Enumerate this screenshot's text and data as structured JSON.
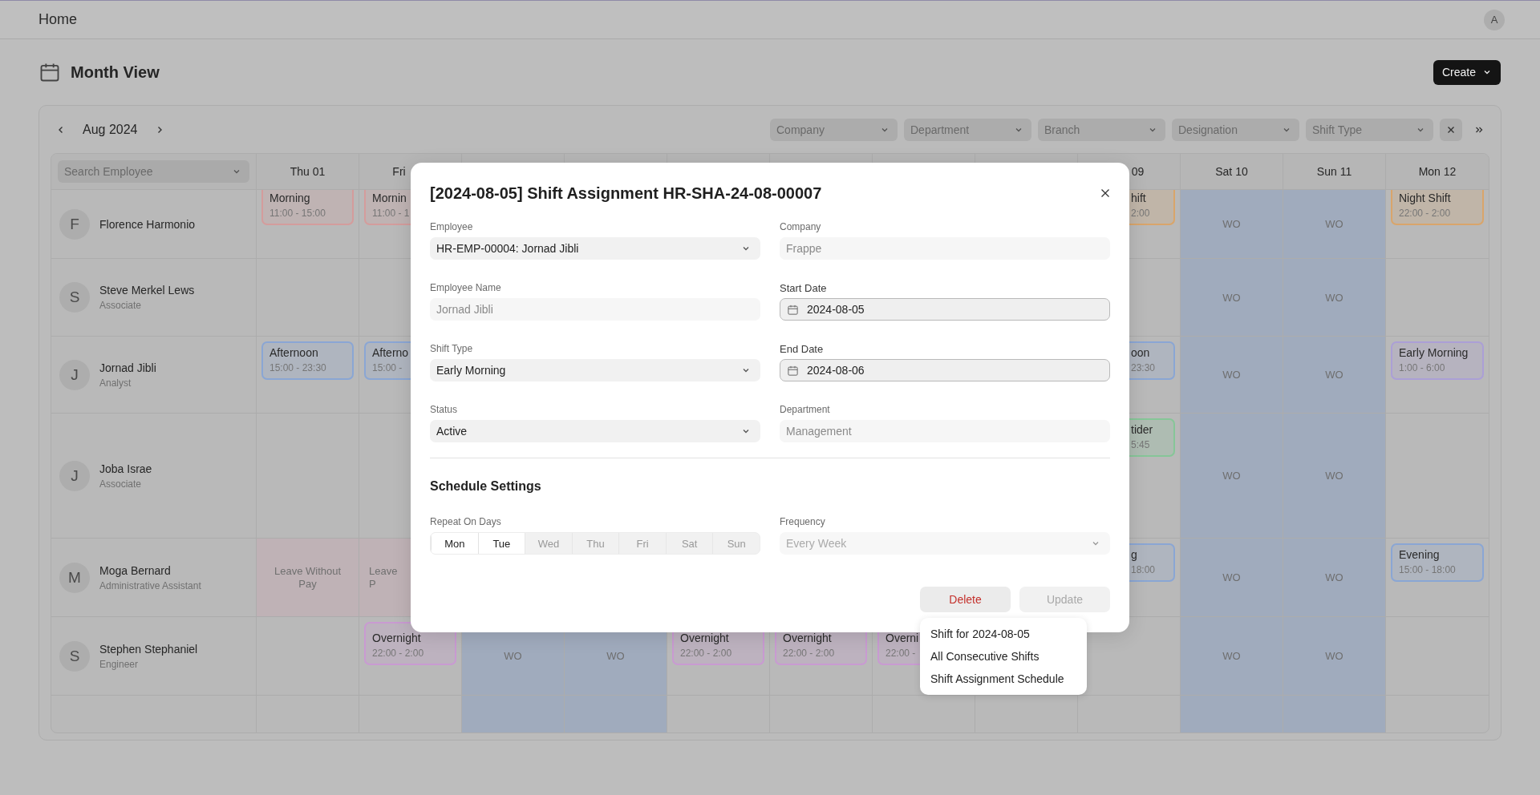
{
  "topbar": {
    "title": "Home",
    "avatar": "A"
  },
  "header": {
    "title": "Month View",
    "create_button": "Create"
  },
  "calendar": {
    "month": "Aug 2024",
    "filters": [
      "Company",
      "Department",
      "Branch",
      "Designation",
      "Shift Type"
    ],
    "search": {
      "placeholder": "Search Employee"
    },
    "days": [
      {
        "label": "Thu 01",
        "weekend": false
      },
      {
        "label": "Fri",
        "weekend": false
      },
      {
        "weekend": true
      },
      {
        "weekend": true
      },
      {
        "weekend": false
      },
      {
        "weekend": false
      },
      {
        "weekend": false
      },
      {
        "weekend": false
      },
      {
        "label": "09",
        "weekend": false
      },
      {
        "label": "Sat 10",
        "weekend": true
      },
      {
        "label": "Sun 11",
        "weekend": true
      },
      {
        "label": "Mon 12",
        "weekend": false
      }
    ],
    "rows": [
      {
        "avatar": "F",
        "name": "Florence Harmonio",
        "cells": [
          {
            "kind": "shift",
            "title": "Morning",
            "time": "11:00 - 15:00",
            "color": "#d49c9c"
          },
          {
            "kind": "shift",
            "title": "Mornin",
            "time": "11:00 - 1",
            "color": "#d49c9c"
          },
          {
            "kind": "empty"
          },
          {
            "kind": "empty"
          },
          {
            "kind": "empty"
          },
          {
            "kind": "empty"
          },
          {
            "kind": "empty"
          },
          {
            "kind": "empty"
          },
          {
            "kind": "shift",
            "title": "hift",
            "time": "2:00",
            "color": "#d9a56a"
          },
          {
            "kind": "off",
            "text": "WO"
          },
          {
            "kind": "off",
            "text": "WO"
          },
          {
            "kind": "shift",
            "title": "Night Shift",
            "time": "22:00 - 2:00",
            "color": "#d9a56a"
          }
        ]
      },
      {
        "avatar": "S",
        "name": "Steve Merkel Lews",
        "designation": "Associate",
        "cells": [
          {
            "kind": "empty"
          },
          {
            "kind": "empty"
          },
          {
            "kind": "empty"
          },
          {
            "kind": "empty"
          },
          {
            "kind": "empty"
          },
          {
            "kind": "empty"
          },
          {
            "kind": "empty"
          },
          {
            "kind": "empty"
          },
          {
            "kind": "empty"
          },
          {
            "kind": "off",
            "text": "WO"
          },
          {
            "kind": "off",
            "text": "WO"
          },
          {
            "kind": "empty"
          }
        ]
      },
      {
        "avatar": "J",
        "name": "Jornad Jibli",
        "designation": "Analyst",
        "cells": [
          {
            "kind": "shift",
            "title": "Afternoon",
            "time": "15:00 - 23:30",
            "color": "#8aa6d4"
          },
          {
            "kind": "shift",
            "title": "Afterno",
            "time": "15:00 -",
            "color": "#8aa6d4"
          },
          {
            "kind": "empty"
          },
          {
            "kind": "empty"
          },
          {
            "kind": "empty"
          },
          {
            "kind": "empty"
          },
          {
            "kind": "empty"
          },
          {
            "kind": "empty"
          },
          {
            "kind": "shift",
            "title": "oon",
            "time": "23:30",
            "color": "#8aa6d4"
          },
          {
            "kind": "off",
            "text": "WO"
          },
          {
            "kind": "off",
            "text": "WO"
          },
          {
            "kind": "shift",
            "title": "Early Morning",
            "time": "1:00 - 6:00",
            "color": "#ab9fd6"
          }
        ]
      },
      {
        "avatar": "J",
        "name": "Joba Israe",
        "designation": "Associate",
        "cells": [
          {
            "kind": "empty"
          },
          {
            "kind": "empty"
          },
          {
            "kind": "empty"
          },
          {
            "kind": "empty"
          },
          {
            "kind": "empty"
          },
          {
            "kind": "empty"
          },
          {
            "kind": "empty"
          },
          {
            "kind": "empty"
          },
          {
            "kind": "shift",
            "title": "tider",
            "time": "5:45",
            "color": "#86c698"
          },
          {
            "kind": "off",
            "text": "WO"
          },
          {
            "kind": "off",
            "text": "WO"
          },
          {
            "kind": "empty"
          }
        ]
      },
      {
        "avatar": "M",
        "name": "Moga Bernard",
        "designation": "Administrative Assistant",
        "cells": [
          {
            "kind": "leave",
            "lines": [
              "Leave Without",
              "Pay"
            ]
          },
          {
            "kind": "leave",
            "lines": [
              "Leave",
              "P"
            ]
          },
          {
            "kind": "empty"
          },
          {
            "kind": "empty"
          },
          {
            "kind": "empty"
          },
          {
            "kind": "empty"
          },
          {
            "kind": "empty"
          },
          {
            "kind": "empty"
          },
          {
            "kind": "shift",
            "title": "g",
            "time": "18:00",
            "color": "#8aa6d4"
          },
          {
            "kind": "off",
            "text": "WO"
          },
          {
            "kind": "off",
            "text": "WO"
          },
          {
            "kind": "shift",
            "title": "Evening",
            "time": "15:00 - 18:00",
            "color": "#8aa6d4"
          }
        ]
      },
      {
        "avatar": "S",
        "name": "Stephen Stephaniel",
        "designation": "Engineer",
        "cells": [
          {
            "kind": "empty"
          },
          {
            "kind": "shift",
            "title": "Overnight",
            "time": "22:00 - 2:00",
            "color": "#c99ad2"
          },
          {
            "kind": "off",
            "text": "WO"
          },
          {
            "kind": "off",
            "text": "WO"
          },
          {
            "kind": "shift",
            "title": "Overnight",
            "time": "22:00 - 2:00",
            "color": "#c99ad2"
          },
          {
            "kind": "shift",
            "title": "Overnight",
            "time": "22:00 - 2:00",
            "color": "#c99ad2"
          },
          {
            "kind": "shift",
            "title": "Overni",
            "time": "22:00 -",
            "color": "#c99ad2"
          },
          {
            "kind": "empty"
          },
          {
            "kind": "empty"
          },
          {
            "kind": "off",
            "text": "WO"
          },
          {
            "kind": "off",
            "text": "WO"
          },
          {
            "kind": "empty"
          }
        ]
      }
    ]
  },
  "dialog": {
    "title": "[2024-08-05] Shift Assignment HR-SHA-24-08-00007",
    "fields": [
      {
        "label": "Employee",
        "value": "HR-EMP-00004: Jornad Jibli",
        "kind": "select"
      },
      {
        "label": "Company",
        "value": "Frappe",
        "kind": "readonly"
      },
      {
        "label": "Employee Name",
        "value": "Jornad Jibli",
        "kind": "readonly"
      },
      {
        "label": "Start Date",
        "value": "2024-08-05",
        "kind": "date"
      },
      {
        "label": "Shift Type",
        "value": "Early Morning",
        "kind": "select"
      },
      {
        "label": "End Date",
        "value": "2024-08-06",
        "kind": "date"
      },
      {
        "label": "Status",
        "value": "Active",
        "kind": "select"
      },
      {
        "label": "Department",
        "value": "Management",
        "kind": "readonly"
      }
    ],
    "section_title": "Schedule Settings",
    "repeat": {
      "label": "Repeat On Days",
      "days": [
        {
          "label": "Mon",
          "selected": true
        },
        {
          "label": "Tue",
          "selected": true
        },
        {
          "label": "Wed",
          "selected": false
        },
        {
          "label": "Thu",
          "selected": false
        },
        {
          "label": "Fri",
          "selected": false
        },
        {
          "label": "Sat",
          "selected": false
        },
        {
          "label": "Sun",
          "selected": false
        }
      ]
    },
    "frequency": {
      "label": "Frequency",
      "value": "Every Week",
      "disabled": true
    },
    "delete_button": "Delete",
    "update_button": {
      "label": "Update",
      "disabled": true
    }
  },
  "delete_menu": [
    "Shift for 2024-08-05",
    "All Consecutive Shifts",
    "Shift Assignment Schedule"
  ]
}
